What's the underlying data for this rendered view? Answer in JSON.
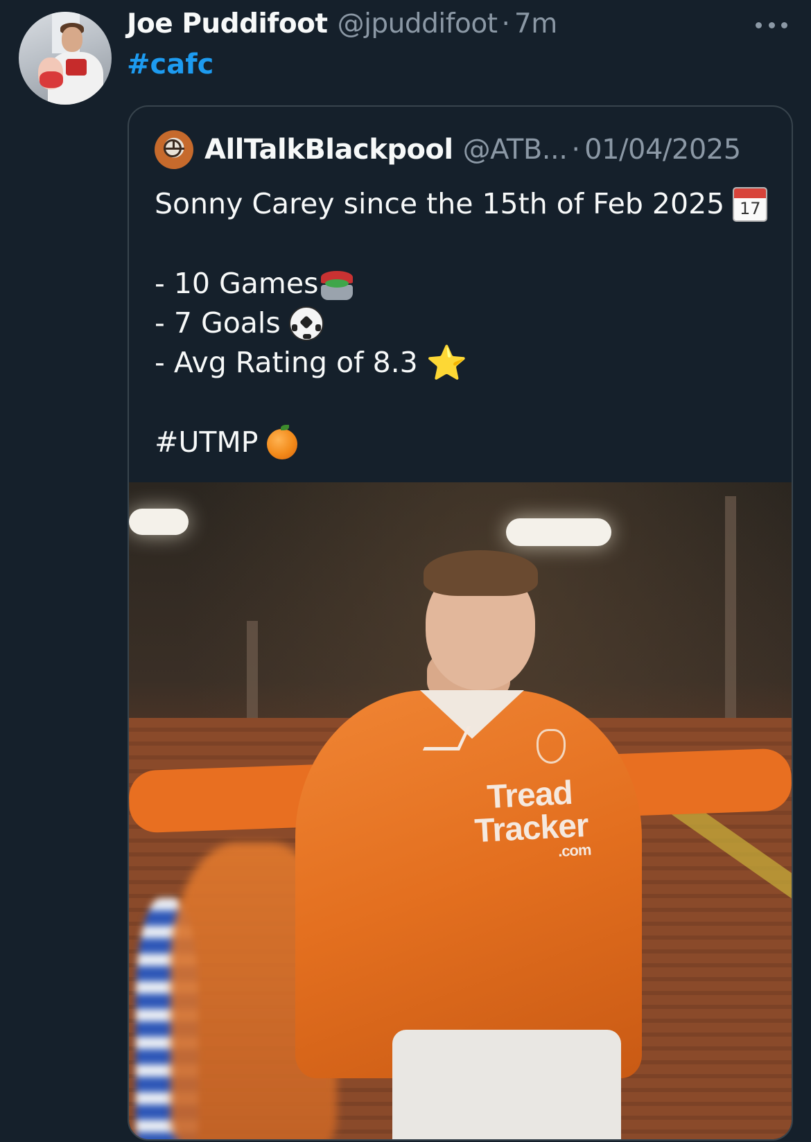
{
  "tweet": {
    "author_name": "Joe Puddifoot",
    "author_handle": "@jpuddifoot",
    "separator": "·",
    "time": "7m",
    "hashtag": "#cafc"
  },
  "quote": {
    "author_name": "AllTalkBlackpool",
    "author_handle": "@ATB...",
    "separator": "·",
    "date": "01/04/2025",
    "lines": {
      "intro": "Sonny Carey since the 15th of Feb 2025",
      "games": "- 10 Games",
      "goals": "- 7 Goals",
      "rating": "- Avg Rating of 8.3",
      "tag": "#UTMP"
    },
    "calendar_emoji_number": "17",
    "star_emoji": "⭐",
    "image": {
      "sponsor_line1": "Tread",
      "sponsor_line2": "Tracker",
      "sponsor_line3": ".com"
    }
  },
  "icons": {
    "more": "more-dots-icon",
    "calendar": "calendar-icon",
    "stadium": "stadium-icon",
    "ball": "soccer-ball-icon",
    "star": "star-icon",
    "orange": "tangerine-icon"
  },
  "colors": {
    "background": "#15202b",
    "link": "#1d9bf0",
    "muted": "#8b98a5",
    "border": "#38444d",
    "text": "#f7f9f9"
  }
}
